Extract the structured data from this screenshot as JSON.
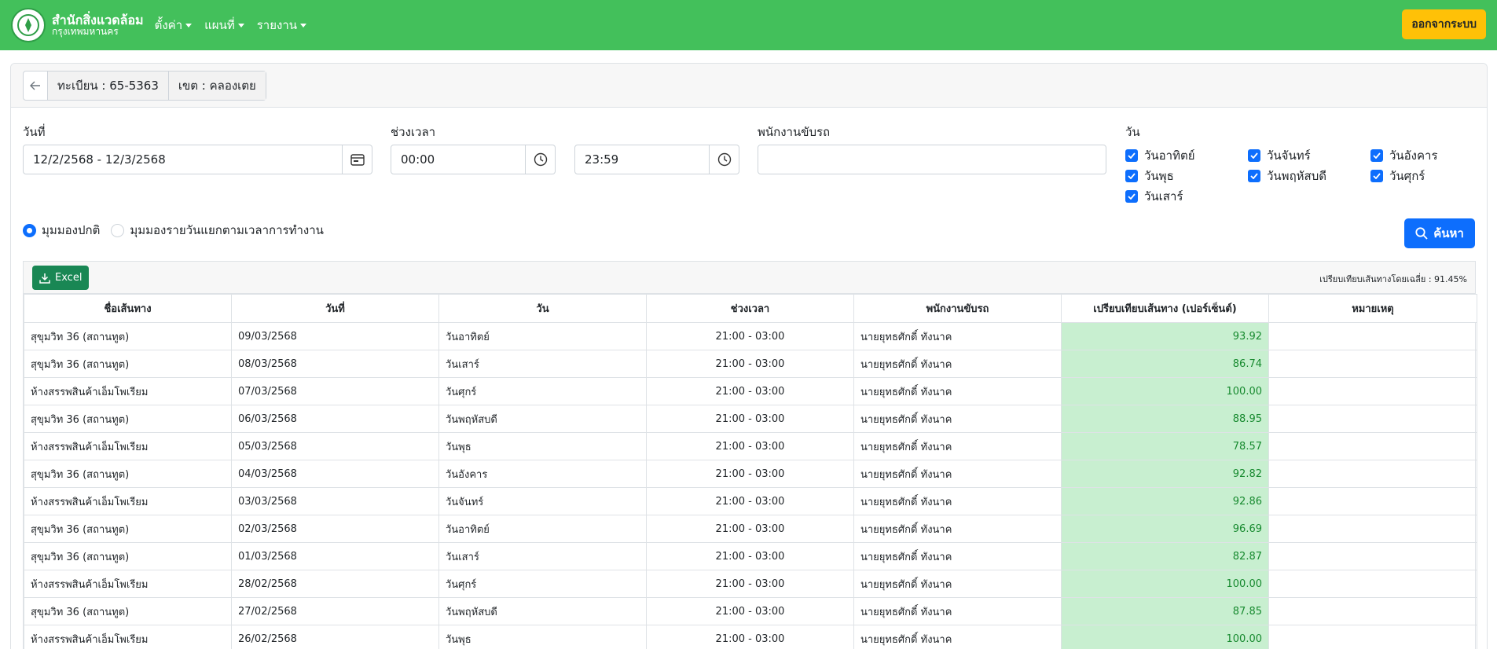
{
  "navbar": {
    "brand_line1": "สำนักสิ่งแวดล้อม",
    "brand_line2": "กรุงเทพมหานคร",
    "menu": [
      {
        "label": "ตั้งค่า"
      },
      {
        "label": "แผนที่"
      },
      {
        "label": "รายงาน"
      }
    ],
    "logout_label": "ออกจากระบบ",
    "bg_color": "#43c05b",
    "logout_color": "#ffc107"
  },
  "header": {
    "registration": "ทะเบียน : 65-5363",
    "district": "เขต : คลองเตย"
  },
  "filters": {
    "date_label": "วันที่",
    "date_value": "12/2/2568 - 12/3/2568",
    "time_label": "ช่วงเวลา",
    "time_start": "00:00",
    "time_end": "23:59",
    "driver_label": "พนักงานขับรถ",
    "driver_value": "",
    "days_label": "วัน",
    "days": [
      {
        "label": "วันอาทิตย์",
        "checked": true
      },
      {
        "label": "วันจันทร์",
        "checked": true
      },
      {
        "label": "วันอังคาร",
        "checked": true
      },
      {
        "label": "วันพุธ",
        "checked": true
      },
      {
        "label": "วันพฤหัสบดี",
        "checked": true
      },
      {
        "label": "วันศุกร์",
        "checked": true
      },
      {
        "label": "วันเสาร์",
        "checked": true
      }
    ],
    "view_normal": "มุมมองปกติ",
    "view_daily": "มุมมองรายวันแยกตามเวลาการทำงาน",
    "selected_view": "normal",
    "search_label": "ค้นหา"
  },
  "table": {
    "excel_label": "Excel",
    "avg_text": "เปรียบเทียบเส้นทางโดยเฉลี่ย : 91.45%",
    "columns": [
      "ชื่อเส้นทาง",
      "วันที่",
      "วัน",
      "ช่วงเวลา",
      "พนักงานขับรถ",
      "เปรียบเทียบเส้นทาง (เปอร์เซ็นต์)",
      "หมายเหตุ"
    ],
    "rows": [
      [
        "สุขุมวิท 36 (สถานทูต)",
        "09/03/2568",
        "วันอาทิตย์",
        "21:00 - 03:00",
        "นายยุทธศักดิ์ ทังนาค",
        "93.92",
        ""
      ],
      [
        "สุขุมวิท 36 (สถานทูต)",
        "08/03/2568",
        "วันเสาร์",
        "21:00 - 03:00",
        "นายยุทธศักดิ์ ทังนาค",
        "86.74",
        ""
      ],
      [
        "ห้างสรรพสินค้าเอ็มโพเรียม",
        "07/03/2568",
        "วันศุกร์",
        "21:00 - 03:00",
        "นายยุทธศักดิ์ ทังนาค",
        "100.00",
        ""
      ],
      [
        "สุขุมวิท 36 (สถานทูต)",
        "06/03/2568",
        "วันพฤหัสบดี",
        "21:00 - 03:00",
        "นายยุทธศักดิ์ ทังนาค",
        "88.95",
        ""
      ],
      [
        "ห้างสรรพสินค้าเอ็มโพเรียม",
        "05/03/2568",
        "วันพุธ",
        "21:00 - 03:00",
        "นายยุทธศักดิ์ ทังนาค",
        "78.57",
        ""
      ],
      [
        "สุขุมวิท 36 (สถานทูต)",
        "04/03/2568",
        "วันอังคาร",
        "21:00 - 03:00",
        "นายยุทธศักดิ์ ทังนาค",
        "92.82",
        ""
      ],
      [
        "ห้างสรรพสินค้าเอ็มโพเรียม",
        "03/03/2568",
        "วันจันทร์",
        "21:00 - 03:00",
        "นายยุทธศักดิ์ ทังนาค",
        "92.86",
        ""
      ],
      [
        "สุขุมวิท 36 (สถานทูต)",
        "02/03/2568",
        "วันอาทิตย์",
        "21:00 - 03:00",
        "นายยุทธศักดิ์ ทังนาค",
        "96.69",
        ""
      ],
      [
        "สุขุมวิท 36 (สถานทูต)",
        "01/03/2568",
        "วันเสาร์",
        "21:00 - 03:00",
        "นายยุทธศักดิ์ ทังนาค",
        "82.87",
        ""
      ],
      [
        "ห้างสรรพสินค้าเอ็มโพเรียม",
        "28/02/2568",
        "วันศุกร์",
        "21:00 - 03:00",
        "นายยุทธศักดิ์ ทังนาค",
        "100.00",
        ""
      ],
      [
        "สุขุมวิท 36 (สถานทูต)",
        "27/02/2568",
        "วันพฤหัสบดี",
        "21:00 - 03:00",
        "นายยุทธศักดิ์ ทังนาค",
        "87.85",
        ""
      ],
      [
        "ห้างสรรพสินค้าเอ็มโพเรียม",
        "26/02/2568",
        "วันพุธ",
        "21:00 - 03:00",
        "นายยุทธศักดิ์ ทังนาค",
        "100.00",
        ""
      ]
    ],
    "pct_bg_color": "#c8efd0"
  }
}
